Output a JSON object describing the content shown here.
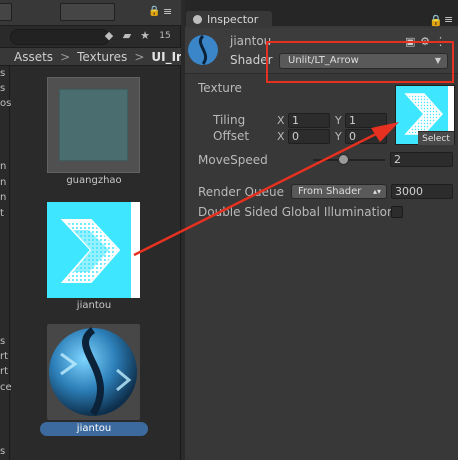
{
  "project": {
    "breadcrumb": [
      "Assets",
      "Textures",
      "UI_Im"
    ],
    "breadcrumb_separator": ">",
    "tree_fragments": [
      "s",
      "s",
      "os",
      "n",
      "n",
      "n",
      "t",
      "s",
      "rt",
      "rt",
      "ce",
      "s"
    ],
    "assets": [
      {
        "label": "guangzhao"
      },
      {
        "label": "jiantou"
      },
      {
        "label": "jiantou",
        "selected": true
      }
    ],
    "toolbar_icons": [
      "tag-icon",
      "label-icon",
      "star-icon",
      "count-icon"
    ],
    "toolbar_count": "15"
  },
  "inspector": {
    "tab_label": "Inspector",
    "material_name": "jiantou",
    "shader_label": "Shader",
    "shader_value": "Unlit/LT_Arrow",
    "texture_label": "Texture",
    "tiling_label": "Tiling",
    "offset_label": "Offset",
    "axis_x": "X",
    "axis_y": "Y",
    "tiling_x": "1",
    "tiling_y": "1",
    "offset_x": "0",
    "offset_y": "0",
    "select_label": "Select",
    "movespeed_label": "MoveSpeed",
    "movespeed_value": "2",
    "movespeed_slider_fraction": 0.42,
    "render_queue_label": "Render Queue",
    "render_queue_mode": "From Shader",
    "render_queue_value": "3000",
    "dsgi_label": "Double Sided Global Illumination",
    "dsgi_checked": false
  },
  "colors": {
    "texture_cyan": "#3ee6ff",
    "annotation_red": "#e63121",
    "selection_blue": "#3d6a9e"
  }
}
